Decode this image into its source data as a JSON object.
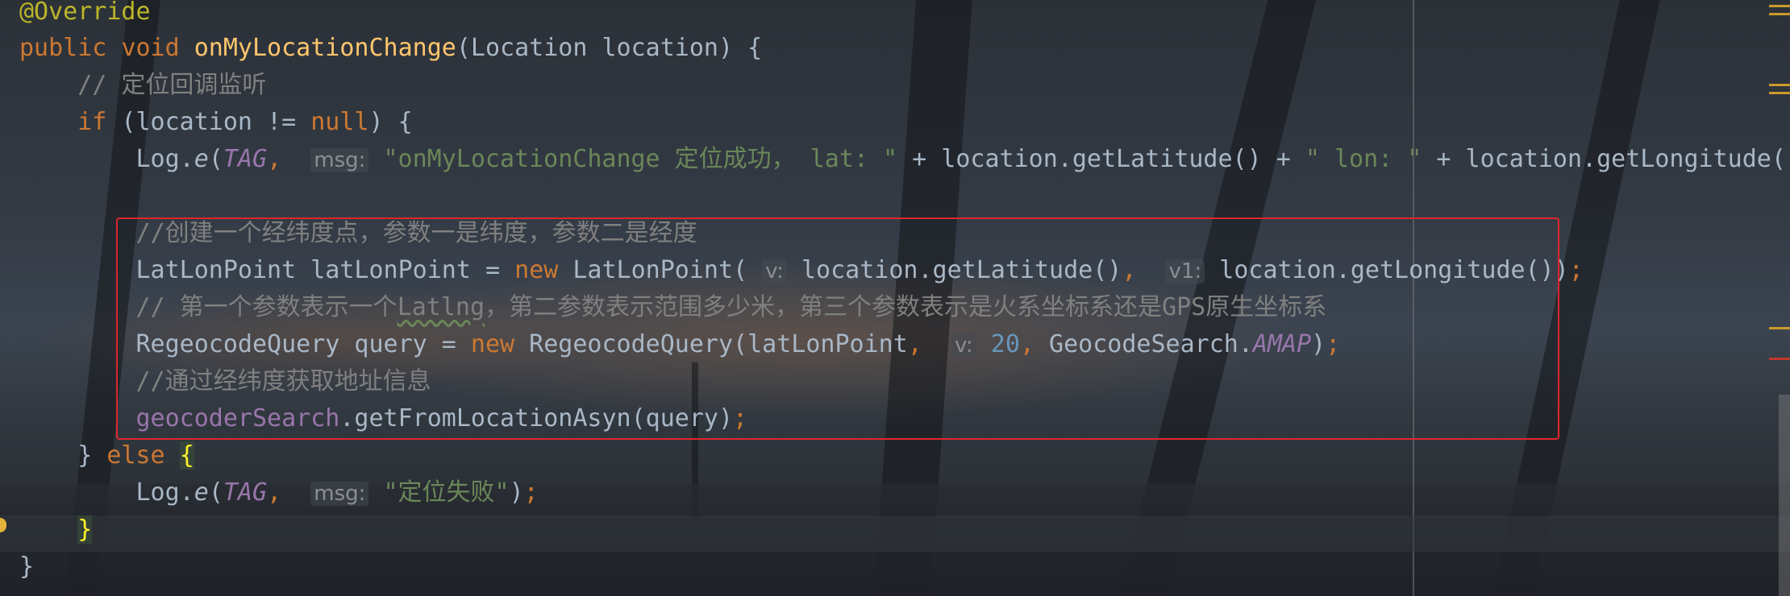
{
  "editor": {
    "lines": [
      {
        "id": "l1",
        "text": "@Override"
      },
      {
        "id": "l2",
        "text": "public void onMyLocationChange(Location location) {"
      },
      {
        "id": "l3",
        "text": "    // 定位回调监听"
      },
      {
        "id": "l4",
        "text": "    if (location != null) {"
      },
      {
        "id": "l5",
        "text": "        Log.e(TAG,  msg: \"onMyLocationChange 定位成功， lat: \" + location.getLatitude() + \" lon: \" + location.getLongitude()"
      },
      {
        "id": "l6",
        "text": ""
      },
      {
        "id": "l7",
        "text": "        //创建一个经纬度点，参数一是纬度，参数二是经度"
      },
      {
        "id": "l8",
        "text": "        LatLonPoint latLonPoint = new LatLonPoint( v: location.getLatitude(),  v1: location.getLongitude());"
      },
      {
        "id": "l9",
        "text": "        // 第一个参数表示一个Latlng，第二参数表示范围多少米，第三个参数表示是火系坐标系还是GPS原生坐标系"
      },
      {
        "id": "l10",
        "text": "        RegeocodeQuery query = new RegeocodeQuery(latLonPoint,  v: 20, GeocodeSearch.AMAP);"
      },
      {
        "id": "l11",
        "text": "        //通过经纬度获取地址信息"
      },
      {
        "id": "l12",
        "text": "        geocoderSearch.getFromLocationAsyn(query);"
      },
      {
        "id": "l13",
        "text": "    } else {"
      },
      {
        "id": "l14",
        "text": "        Log.e(TAG,  msg: \"定位失败\");"
      },
      {
        "id": "l15",
        "text": "    }"
      },
      {
        "id": "l16",
        "text": "}"
      }
    ],
    "tokens": {
      "override": "@Override",
      "public": "public",
      "void": "void",
      "method_name": "onMyLocationChange",
      "params": "(Location location) {",
      "comment1": "// 定位回调监听",
      "if": "if",
      "cond_open": " (location != ",
      "null": "null",
      "cond_close": ") {",
      "log": "Log.",
      "e": "e",
      "paren_open": "(",
      "tag": "TAG",
      "comma": ",",
      "hint_msg": "msg:",
      "str_success": "\"onMyLocationChange 定位成功， lat: \"",
      "plus_lat": " + location.getLatitude() + ",
      "str_lon": "\" lon: \"",
      "plus_lon": " + location.getLongitude()",
      "comment2": "//创建一个经纬度点，参数一是纬度，参数二是经度",
      "latlon_decl": "LatLonPoint latLonPoint = ",
      "new": "new",
      "latlon_ctor": " LatLonPoint(",
      "hint_v": "v:",
      "getlat": " location.getLatitude()",
      "hint_v1": "v1:",
      "getlon": " location.getLongitude())",
      "semicolon": ";",
      "comment3_a": "// 第一个参数表示一个",
      "comment3_typo": "Latlng",
      "comment3_b": "，第二参数表示范围多少米，第三个参数表示是火系坐标系还是GPS原生坐标系",
      "query_decl": "RegeocodeQuery query = ",
      "query_ctor": " RegeocodeQuery(latLonPoint",
      "num20": "20",
      "geosearch": " GeocodeSearch.",
      "amap": "AMAP",
      "close_paren": ")",
      "comment4": "//通过经纬度获取地址信息",
      "geocoder": "geocoderSearch",
      "getfrom": ".getFromLocationAsyn(query)",
      "else_close": "} ",
      "else": "else",
      "brace_open": "{",
      "str_fail": "\"定位失败\"",
      "close_stmt": ")",
      "brace_close": "}",
      "outer_close": "}"
    },
    "colors": {
      "keyword": "#cc7832",
      "method": "#ffc66d",
      "comment": "#808080",
      "string": "#6a8759",
      "number": "#6897bb",
      "constant": "#9876aa",
      "selection_border": "#e0262a"
    }
  }
}
